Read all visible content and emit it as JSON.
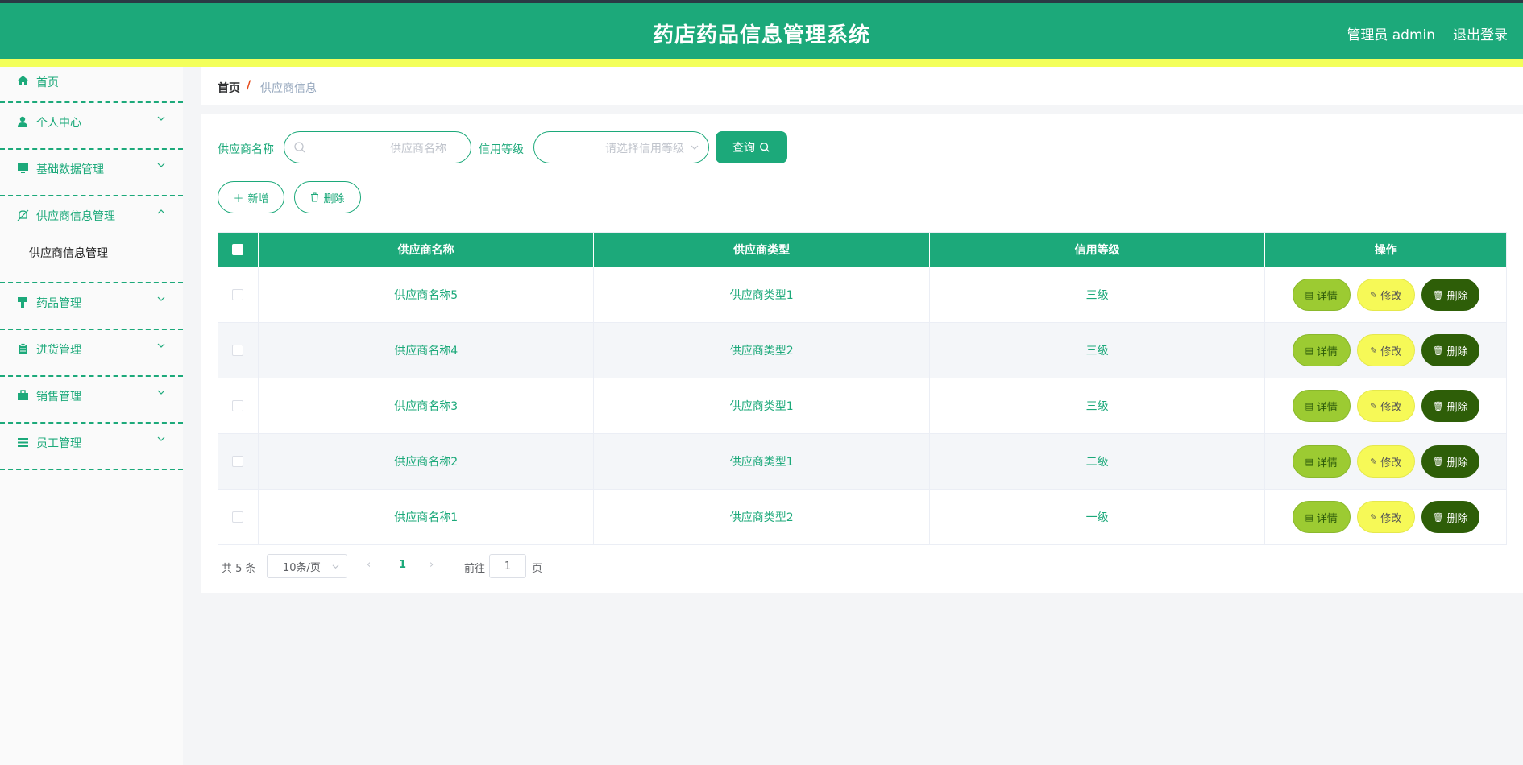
{
  "header": {
    "title": "药店药品信息管理系统",
    "user": "管理员 admin",
    "logout": "退出登录"
  },
  "sidebar": {
    "items": [
      {
        "label": "首页",
        "icon": "home-icon"
      },
      {
        "label": "个人中心",
        "icon": "user-icon"
      },
      {
        "label": "基础数据管理",
        "icon": "monitor-icon"
      },
      {
        "label": "供应商信息管理",
        "icon": "bell-off-icon",
        "sub": "供应商信息管理"
      },
      {
        "label": "药品管理",
        "icon": "brush-icon"
      },
      {
        "label": "进货管理",
        "icon": "clipboard-icon"
      },
      {
        "label": "销售管理",
        "icon": "briefcase-icon"
      },
      {
        "label": "员工管理",
        "icon": "list-icon"
      }
    ]
  },
  "breadcrumb": {
    "home": "首页",
    "sep": "/",
    "current": "供应商信息"
  },
  "search": {
    "name_label": "供应商名称",
    "name_placeholder": "供应商名称",
    "credit_label": "信用等级",
    "credit_placeholder": "请选择信用等级",
    "query": "查询"
  },
  "actions": {
    "add": "新增",
    "delete": "删除"
  },
  "table": {
    "headers": [
      "供应商名称",
      "供应商类型",
      "信用等级",
      "操作"
    ],
    "rows": [
      {
        "name": "供应商名称5",
        "type": "供应商类型1",
        "credit": "三级"
      },
      {
        "name": "供应商名称4",
        "type": "供应商类型2",
        "credit": "三级"
      },
      {
        "name": "供应商名称3",
        "type": "供应商类型1",
        "credit": "三级"
      },
      {
        "name": "供应商名称2",
        "type": "供应商类型1",
        "credit": "二级"
      },
      {
        "name": "供应商名称1",
        "type": "供应商类型2",
        "credit": "一级"
      }
    ],
    "ops": {
      "detail": "详情",
      "edit": "修改",
      "delete": "删除"
    }
  },
  "pagination": {
    "total": "共 5 条",
    "page_size": "10条/页",
    "current": "1",
    "goto": "前往",
    "goto_value": "1",
    "page_suffix": "页"
  },
  "colors": {
    "primary": "#1ca97a",
    "accent_bar": "#f3ff5a",
    "detail": "#9ccb32",
    "edit": "#f6f957",
    "delete": "#2e5e08"
  }
}
